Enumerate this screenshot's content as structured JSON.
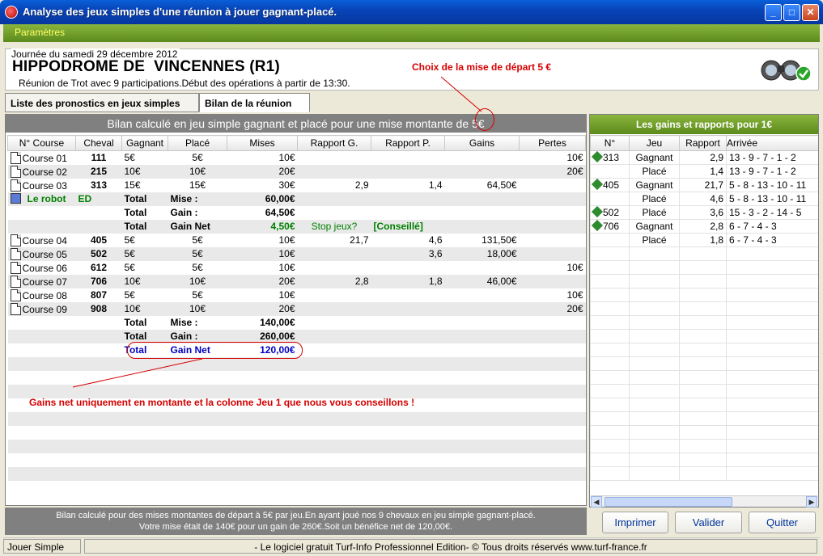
{
  "window": {
    "title": "Analyse des jeux simples d'une réunion à jouer gagnant-placé.",
    "minimize": "_",
    "maximize": "□",
    "close": "✕"
  },
  "menu": {
    "items": [
      "Paramètres"
    ]
  },
  "header": {
    "date": "Journée du samedi 29 décembre 2012",
    "hippodrome": "HIPPODROME DE  VINCENNES (R1)",
    "reunion": "Réunion de Trot avec 9 participations.Début des opérations à partir de 13:30.",
    "annotation": "Choix de la mise de départ 5 €"
  },
  "tabs": [
    "Liste des pronostics en jeux simples",
    "Bilan de la réunion"
  ],
  "left": {
    "header": "Bilan calculé en jeu simple gagnant et placé pour une mise montante de 5€",
    "columns": [
      "N° Course",
      "Cheval",
      "Gagnant",
      "Placé",
      "Mises",
      "Rapport G.",
      "Rapport P.",
      "Gains",
      "Pertes"
    ],
    "rows": [
      {
        "type": "course",
        "course": "Course 01",
        "cheval": "111",
        "gagnant": "5€",
        "place": "5€",
        "mises": "10€",
        "rg": "",
        "rp": "",
        "gains": "",
        "pertes": "10€"
      },
      {
        "type": "course",
        "course": "Course 02",
        "cheval": "215",
        "gagnant": "10€",
        "place": "10€",
        "mises": "20€",
        "rg": "",
        "rp": "",
        "gains": "",
        "pertes": "20€"
      },
      {
        "type": "course",
        "course": "Course 03",
        "cheval": "313",
        "gagnant": "15€",
        "place": "15€",
        "mises": "30€",
        "rg": "2,9",
        "rp": "1,4",
        "gains": "64,50€",
        "pertes": ""
      },
      {
        "type": "robot",
        "robot": "Le robot",
        "code": "ED",
        "t1": "Total",
        "t2": "Mise :",
        "val": "60,00€"
      },
      {
        "type": "total",
        "t1": "Total",
        "t2": "Gain :",
        "val": "64,50€"
      },
      {
        "type": "totalnet",
        "t1": "Total",
        "t2": "Gain Net",
        "val": "4,50€",
        "stop": "Stop jeux?",
        "conseil": "[Conseillé]"
      },
      {
        "type": "course",
        "course": "Course 04",
        "cheval": "405",
        "gagnant": "5€",
        "place": "5€",
        "mises": "10€",
        "rg": "21,7",
        "rp": "4,6",
        "gains": "131,50€",
        "pertes": ""
      },
      {
        "type": "course",
        "course": "Course 05",
        "cheval": "502",
        "gagnant": "5€",
        "place": "5€",
        "mises": "10€",
        "rg": "",
        "rp": "3,6",
        "gains": "18,00€",
        "pertes": ""
      },
      {
        "type": "course",
        "course": "Course 06",
        "cheval": "612",
        "gagnant": "5€",
        "place": "5€",
        "mises": "10€",
        "rg": "",
        "rp": "",
        "gains": "",
        "pertes": "10€"
      },
      {
        "type": "course",
        "course": "Course 07",
        "cheval": "706",
        "gagnant": "10€",
        "place": "10€",
        "mises": "20€",
        "rg": "2,8",
        "rp": "1,8",
        "gains": "46,00€",
        "pertes": ""
      },
      {
        "type": "course",
        "course": "Course 08",
        "cheval": "807",
        "gagnant": "5€",
        "place": "5€",
        "mises": "10€",
        "rg": "",
        "rp": "",
        "gains": "",
        "pertes": "10€"
      },
      {
        "type": "course",
        "course": "Course 09",
        "cheval": "908",
        "gagnant": "10€",
        "place": "10€",
        "mises": "20€",
        "rg": "",
        "rp": "",
        "gains": "",
        "pertes": "20€"
      },
      {
        "type": "total",
        "t1": "Total",
        "t2": "Mise :",
        "val": "140,00€"
      },
      {
        "type": "total",
        "t1": "Total",
        "t2": "Gain :",
        "val": "260,00€"
      },
      {
        "type": "finalnet",
        "t1": "Total",
        "t2": "Gain Net",
        "val": "120,00€"
      }
    ],
    "annotation": "Gains net uniquement en montante et la colonne Jeu 1 que nous vous conseillons !",
    "footer_line1": "Bilan calculé pour des mises montantes de départ à 5€ par jeu.En ayant joué nos 9 chevaux en jeu simple gagnant-placé.",
    "footer_line2": "Votre mise était de 140€ pour un gain de 260€.Soit un bénéfice net de 120,00€."
  },
  "right": {
    "header": "Les gains et rapports pour 1€",
    "columns": [
      "N°",
      "Jeu",
      "Rapport",
      "Arrivée"
    ],
    "rows": [
      {
        "num": "313",
        "jeu": "Gagnant",
        "rapport": "2,9",
        "arrivee": "13 - 9 - 7 - 1 - 2",
        "win": true
      },
      {
        "num": "",
        "jeu": "Placé",
        "rapport": "1,4",
        "arrivee": "13 - 9 - 7 - 1 - 2",
        "win": false
      },
      {
        "num": "405",
        "jeu": "Gagnant",
        "rapport": "21,7",
        "arrivee": "5 - 8 - 13 - 10 - 11",
        "win": true
      },
      {
        "num": "",
        "jeu": "Placé",
        "rapport": "4,6",
        "arrivee": "5 - 8 - 13 - 10 - 11",
        "win": false
      },
      {
        "num": "502",
        "jeu": "Placé",
        "rapport": "3,6",
        "arrivee": "15 - 3 - 2 - 14 - 5",
        "win": true
      },
      {
        "num": "706",
        "jeu": "Gagnant",
        "rapport": "2,8",
        "arrivee": "6 - 7 - 4 - 3",
        "win": true
      },
      {
        "num": "",
        "jeu": "Placé",
        "rapport": "1,8",
        "arrivee": "6 - 7 - 4 - 3",
        "win": false
      }
    ]
  },
  "buttons": {
    "print": "Imprimer",
    "validate": "Valider",
    "quit": "Quitter"
  },
  "status": {
    "left": "Jouer Simple",
    "right": "- Le logiciel gratuit Turf-Info Professionnel Edition- © Tous droits réservés www.turf-france.fr"
  },
  "colors": {
    "accent_green": "#6b9a25",
    "annotation_red": "#d60000",
    "net_blue": "#0000c0",
    "net_green": "#008000"
  }
}
